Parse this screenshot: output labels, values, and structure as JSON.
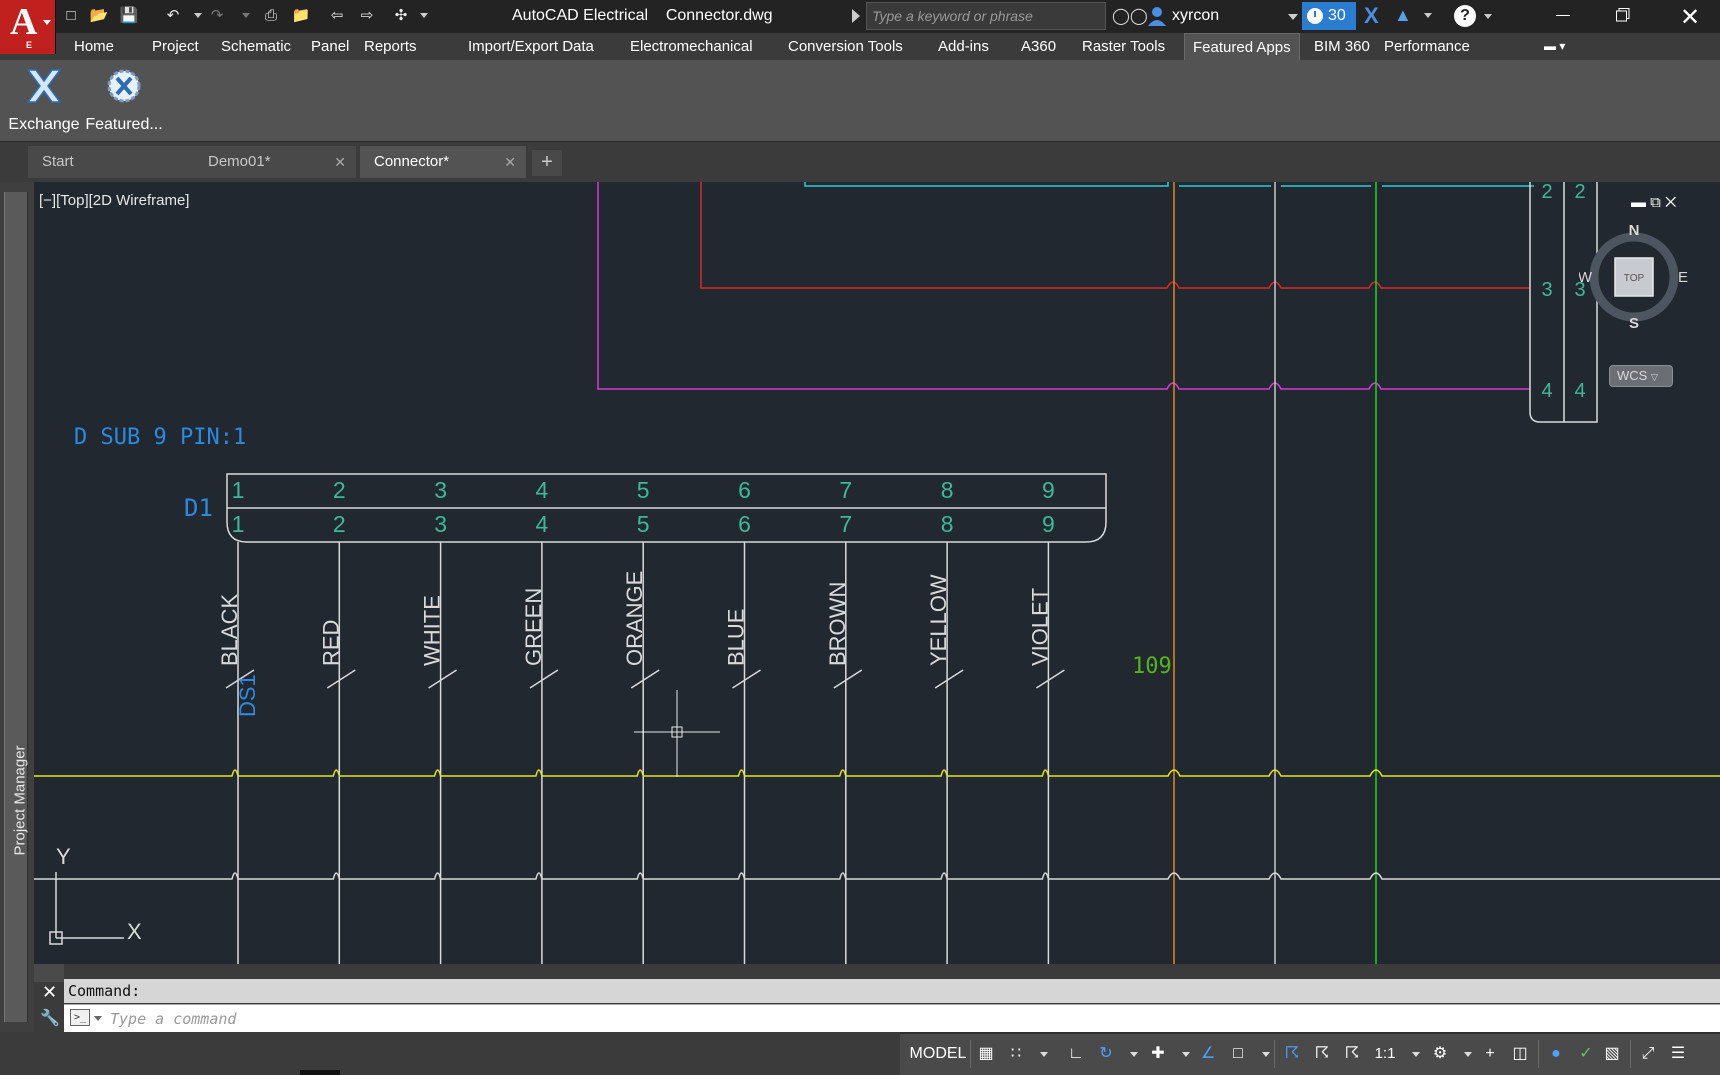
{
  "app": {
    "title": "AutoCAD Electrical    Connector.dwg",
    "logo_letter": "A",
    "logo_sub": "E",
    "search_placeholder": "Type a keyword or phrase",
    "user_name": "xyrcon",
    "trial_days": "30"
  },
  "ribbon": {
    "tabs": [
      {
        "label": "Home"
      },
      {
        "label": "Project"
      },
      {
        "label": "Schematic"
      },
      {
        "label": "Panel"
      },
      {
        "label": "Reports"
      },
      {
        "label": "Import/Export Data"
      },
      {
        "label": "Electromechanical"
      },
      {
        "label": "Conversion Tools"
      },
      {
        "label": "Add-ins"
      },
      {
        "label": "A360"
      },
      {
        "label": "Raster Tools"
      },
      {
        "label": "Featured Apps",
        "active": true
      },
      {
        "label": "BIM 360"
      },
      {
        "label": "Performance"
      }
    ],
    "buttons": [
      {
        "label": "Exchange",
        "icon": "exchange-icon"
      },
      {
        "label": "Featured...",
        "icon": "featured-apps-icon"
      }
    ]
  },
  "doc_tabs": [
    {
      "label": "Start"
    },
    {
      "label": "Demo01*"
    },
    {
      "label": "Connector*",
      "active": true
    }
  ],
  "project_manager": {
    "label": "Project Manager"
  },
  "viewport": {
    "label": "[−][Top][2D Wireframe]",
    "viewcube": {
      "top_face": "TOP",
      "n": "N",
      "s": "S",
      "e": "E",
      "w": "W"
    },
    "wcs": "WCS"
  },
  "schematic": {
    "connector_title": "D SUB 9 PIN:1",
    "connector_tag": "D1",
    "pins": [
      "1",
      "2",
      "3",
      "4",
      "5",
      "6",
      "7",
      "8",
      "9"
    ],
    "wires": [
      "BLACK",
      "RED",
      "WHITE",
      "GREEN",
      "ORANGE",
      "BLUE",
      "BROWN",
      "YELLOW",
      "VIOLET"
    ],
    "cable_tag": "DS1",
    "line_ref": "109",
    "right_terminals": [
      "2",
      "3",
      "4"
    ],
    "ucs": {
      "x": "X",
      "y": "Y"
    },
    "colors": {
      "wire": "#d9d9d9",
      "pin_text": "#3fb89a",
      "label_blue": "#2b8ae0",
      "bus_yellow": "#e5e51c",
      "bus_magenta": "#d83bd8",
      "bus_red": "#d92a2a",
      "bus_cyan": "#2ccfd6",
      "vert_orange": "#e3891c",
      "vert_green": "#1ed61e",
      "line_ref_green": "#58b31a"
    }
  },
  "command": {
    "history": "Command:",
    "placeholder": "Type a command"
  },
  "statusbar": {
    "model": "MODEL",
    "scale": "1:1"
  }
}
